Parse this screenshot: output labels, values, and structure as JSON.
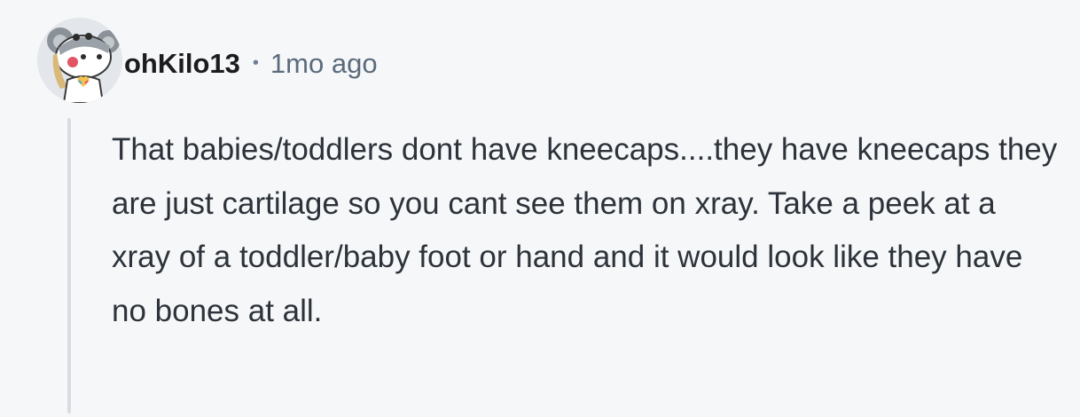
{
  "comment": {
    "author": {
      "username": "ohKilo13",
      "avatar_icon": "snoo-koala-avatar-icon"
    },
    "separator": "•",
    "timestamp": "1mo ago",
    "body": "That babies/toddlers dont have kneecaps....they have kneecaps they are just cartilage so you cant see them on xray. Take a peek at a xray of a toddler/baby foot or hand and it would look like they have no bones at all."
  },
  "colors": {
    "background": "#f6f7f9",
    "username": "#1c1c1c",
    "timestamp": "#5b6b7b",
    "body_text": "#2d333a",
    "thread_line": "#d8dde2"
  }
}
